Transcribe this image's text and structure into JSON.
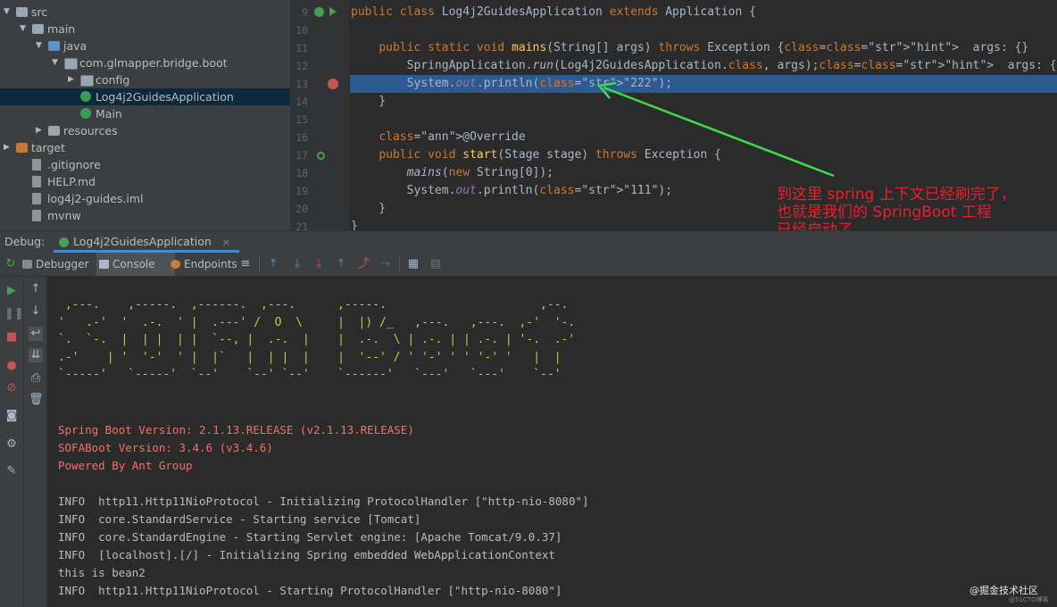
{
  "tree": [
    {
      "label": "src",
      "indent": 0,
      "arrow": "▼",
      "icon": "folder"
    },
    {
      "label": "main",
      "indent": 1,
      "arrow": "▼",
      "icon": "folder"
    },
    {
      "label": "java",
      "indent": 2,
      "arrow": "▼",
      "icon": "folder-blue"
    },
    {
      "label": "com.glmapper.bridge.boot",
      "indent": 3,
      "arrow": "▼",
      "icon": "package"
    },
    {
      "label": "config",
      "indent": 4,
      "arrow": "▶",
      "icon": "package"
    },
    {
      "label": "Log4j2GuidesApplication",
      "indent": 4,
      "arrow": "",
      "icon": "class",
      "selected": true
    },
    {
      "label": "Main",
      "indent": 4,
      "arrow": "",
      "icon": "class"
    },
    {
      "label": "resources",
      "indent": 2,
      "arrow": "▶",
      "icon": "folder"
    },
    {
      "label": "target",
      "indent": 0,
      "arrow": "▶",
      "icon": "folder-orange"
    },
    {
      "label": ".gitignore",
      "indent": 1,
      "arrow": "",
      "icon": "file"
    },
    {
      "label": "HELP.md",
      "indent": 1,
      "arrow": "",
      "icon": "file"
    },
    {
      "label": "log4j2-guides.iml",
      "indent": 1,
      "arrow": "",
      "icon": "file"
    },
    {
      "label": "mvnw",
      "indent": 1,
      "arrow": "",
      "icon": "file"
    }
  ],
  "editor": {
    "line_numbers": [
      "9",
      "10",
      "11",
      "12",
      "13",
      "14",
      "15",
      "16",
      "17",
      "18",
      "19",
      "20",
      "21"
    ],
    "lines": [
      "public class Log4j2GuidesApplication extends Application {",
      "",
      "    public static void mains(String[] args) throws Exception {  args: {}",
      "        SpringApplication.run(Log4j2GuidesApplication.class, args);  args: {}",
      "        System.out.println(\"222\");",
      "    }",
      "",
      "    @Override",
      "    public void start(Stage stage) throws Exception {",
      "        mains(new String[0]);",
      "        System.out.println(\"111\");",
      "    }",
      "}"
    ]
  },
  "annotation": {
    "lines": [
      "到这里 spring 上下文已经刷完了，",
      "也就是我们的 SpringBoot 工程",
      "已经启动了"
    ],
    "color": "#e8202a"
  },
  "debug": {
    "label": "Debug:",
    "tab": "Log4j2GuidesApplication",
    "close": "×",
    "toolbar_tabs": [
      "Debugger",
      "Console",
      "Endpoints"
    ]
  },
  "console": {
    "banner": [
      " ,---.    ,-----.  ,------.  ,---.      ,-----.                      ,--.   ",
      "'   .-'  '  .-.  ' |  .---' /  O  \\     |  |) /_   ,---.   ,---.  ,-'  '-. ",
      "`.  `-.  |  | |  | |  `--, |  .-.  |    |  .-.  \\ | .-. | | .-. | '-.  .-' ",
      ".-'    | '  '-'  ' |  |`   |  | |  |    |  '--' / ' '-' ' ' '-' '   |  |   ",
      "`-----'   `-----'  `--'    `--' `--'    `------'   `---'   `---'    `--'   "
    ],
    "red_lines": [
      "Spring Boot Version: 2.1.13.RELEASE (v2.1.13.RELEASE)",
      "SOFABoot Version: 3.4.6 (v3.4.6)",
      "Powered By Ant Group"
    ],
    "log_lines": [
      "INFO  http11.Http11NioProtocol - Initializing ProtocolHandler [\"http-nio-8080\"]",
      "INFO  core.StandardService - Starting service [Tomcat]",
      "INFO  core.StandardEngine - Starting Servlet engine: [Apache Tomcat/9.0.37]",
      "INFO  [localhost].[/] - Initializing Spring embedded WebApplicationContext",
      "this is bean2",
      "INFO  http11.Http11NioProtocol - Starting ProtocolHandler [\"http-nio-8080\"]"
    ]
  },
  "watermark": "@掘金技术社区",
  "watermark_small": "@51CTO博客"
}
